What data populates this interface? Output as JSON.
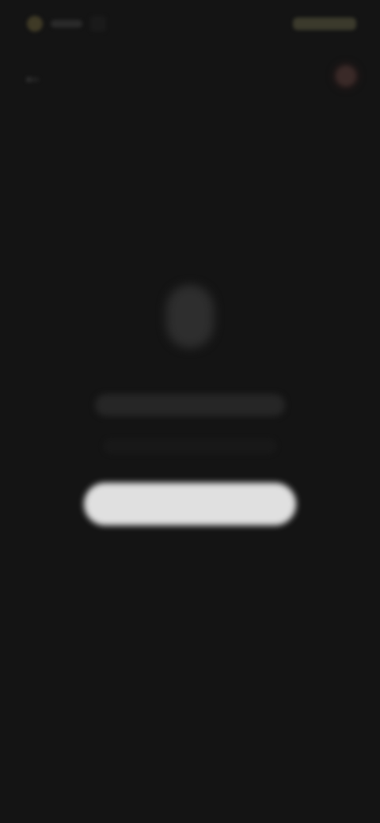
{
  "status_bar": {
    "time": "",
    "icons": [
      "notification-icon",
      "camera-notch",
      "signal-icon"
    ]
  },
  "app_bar": {
    "back_icon": "arrow-left-icon",
    "title": "",
    "avatar_icon": "avatar"
  },
  "empty_state": {
    "icon": "document-icon",
    "message": "",
    "sub_message": "",
    "button_label": ""
  },
  "colors": {
    "background": "#141414",
    "button": "#e0e0e0",
    "accent": "#3a2a28"
  }
}
